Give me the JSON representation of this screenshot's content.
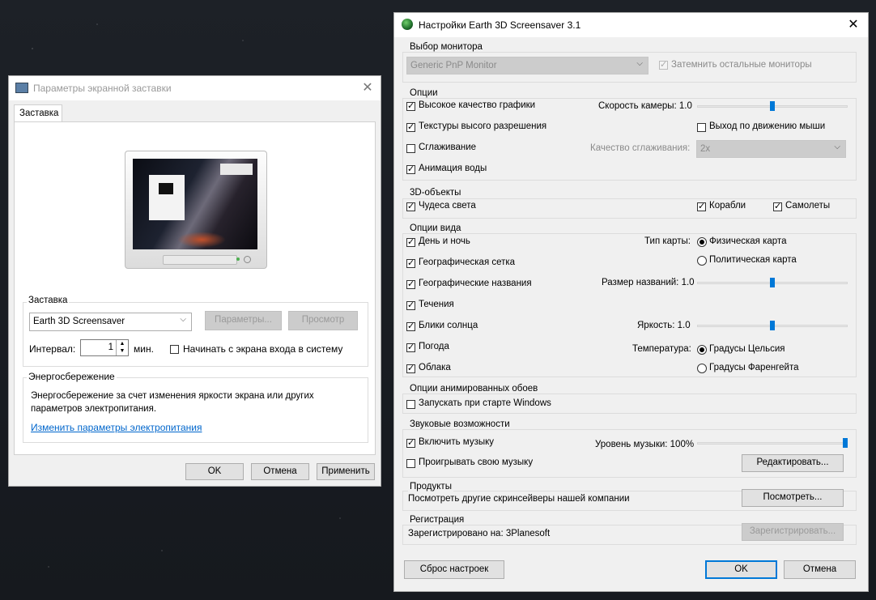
{
  "screensaver_dialog": {
    "title": "Параметры экранной заставки",
    "tab": "Заставка",
    "group_screensaver": "Заставка",
    "selected_screensaver": "Earth 3D Screensaver",
    "settings_button": "Параметры...",
    "preview_button": "Просмотр",
    "interval_label": "Интервал:",
    "interval_value": "1",
    "interval_unit": "мин.",
    "logon_screen_label": "Начинать с экрана входа в систему",
    "power_group": "Энергосбережение",
    "power_text": "Энергосбережение за счет изменения яркости экрана или других параметров электропитания.",
    "power_link": "Изменить параметры электропитания",
    "ok": "OK",
    "cancel": "Отмена",
    "apply": "Применить"
  },
  "earth_dialog": {
    "title": "Настройки Earth 3D Screensaver 3.1",
    "monitor_group": "Выбор монитора",
    "monitor_value": "Generic PnP Monitor",
    "dim_other": "Затемнить остальные мониторы",
    "options_group": "Опции",
    "hq_graphics": "Высокое качество графики",
    "camera_speed": "Скорость камеры: 1.0",
    "hires_textures": "Текстуры высого разрешения",
    "exit_mouse": "Выход по движению мыши",
    "antialiasing": "Сглаживание",
    "aa_quality_label": "Качество сглаживания:",
    "aa_quality_value": "2x",
    "water_anim": "Анимация воды",
    "objects_group": "3D-объекты",
    "wonders": "Чудеса света",
    "ships": "Корабли",
    "planes": "Самолеты",
    "view_group": "Опции вида",
    "day_night": "День и ночь",
    "map_type_label": "Тип карты:",
    "physical_map": "Физическая карта",
    "political_map": "Политическая карта",
    "geo_grid": "Географическая сетка",
    "geo_names": "Географические названия",
    "names_size": "Размер названий: 1.0",
    "currents": "Течения",
    "sun_glare": "Блики солнца",
    "brightness": "Яркость: 1.0",
    "weather": "Погода",
    "temperature_label": "Температура:",
    "celsius": "Градусы Цельсия",
    "clouds": "Облака",
    "fahrenheit": "Градусы Фаренгейта",
    "wallpaper_group": "Опции анимированных обоев",
    "start_windows": "Запускать при старте Windows",
    "sound_group": "Звуковые возможности",
    "enable_music": "Включить музыку",
    "music_level": "Уровень музыки: 100%",
    "play_own": "Проигрывать свою музыку",
    "edit_button": "Редактировать...",
    "products_group": "Продукты",
    "products_text": "Посмотреть другие скринсейверы нашей компании",
    "view_button": "Посмотреть...",
    "reg_group": "Регистрация",
    "reg_text": "Зарегистрировано на: 3Planesoft",
    "register_button": "Зарегистрировать...",
    "reset_button": "Сброс настроек",
    "ok": "OK",
    "cancel": "Отмена"
  },
  "sliders": {
    "camera_speed": 0.5,
    "names_size": 0.5,
    "brightness": 0.5,
    "music_level": 1.0
  },
  "colors": {
    "accent": "#0078d7",
    "link": "#0066cc"
  }
}
